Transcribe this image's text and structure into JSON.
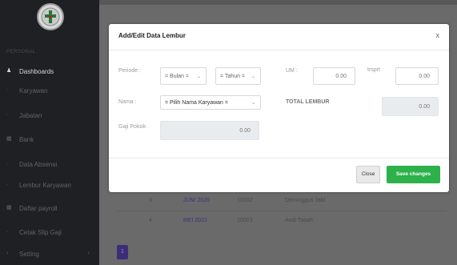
{
  "sidebar": {
    "caption": "PERSONAL",
    "items": [
      {
        "label": "Dashboards",
        "icon": "user-icon",
        "active": true
      },
      {
        "label": "Karyawan",
        "icon": "dot-icon"
      },
      {
        "label": "Jabatan",
        "icon": "dot-icon"
      },
      {
        "label": "Bank",
        "icon": "grid-icon"
      },
      {
        "label": "Data Absensi",
        "icon": "dot-icon"
      },
      {
        "label": "Lembur Karyawan",
        "icon": "dot-icon"
      },
      {
        "label": "Daftar payroll",
        "icon": "grid-icon"
      },
      {
        "label": "Cetak Slip Gaji",
        "icon": "dot-icon"
      },
      {
        "label": "Setting",
        "icon": "chevron-icon"
      }
    ]
  },
  "page": {
    "heading_letter": "I"
  },
  "background_table": {
    "rows": [
      {
        "no": "3",
        "periode": "JUNI 2020",
        "nik": "10002",
        "nama": "Deminggus Jabi"
      },
      {
        "no": "4",
        "periode": "MEI 2022",
        "nik": "10003",
        "nama": "Andi Tabah"
      }
    ]
  },
  "pagination": {
    "current": "1"
  },
  "modal": {
    "title": "Add/Edit Data Lembur",
    "close_symbol": "x",
    "periode_label": "Periode :",
    "bulan_select": "= Bulan =",
    "tahun_select": "= Tahun =",
    "um_label": "UM :",
    "um_value": "0.00",
    "trsprt_label": "trsprt",
    "trsprt_value": "0.00",
    "nama_label": "Nama :",
    "nama_select": "= Pilih Nama Karyawan =",
    "total_lembur_label": "TOTAL LEMBUR",
    "total_lembur_value": "0.00",
    "gaji_pokok_label": "Gaji Pokok:",
    "gaji_pokok_value": "0.00",
    "close_button": "Close",
    "save_button": "Save changes"
  },
  "colors": {
    "save_button": "#2db14a",
    "sidebar_bg": "#1e2024",
    "overlay_bg": "#6a6a6a",
    "pager_bg": "#3d2d79"
  }
}
